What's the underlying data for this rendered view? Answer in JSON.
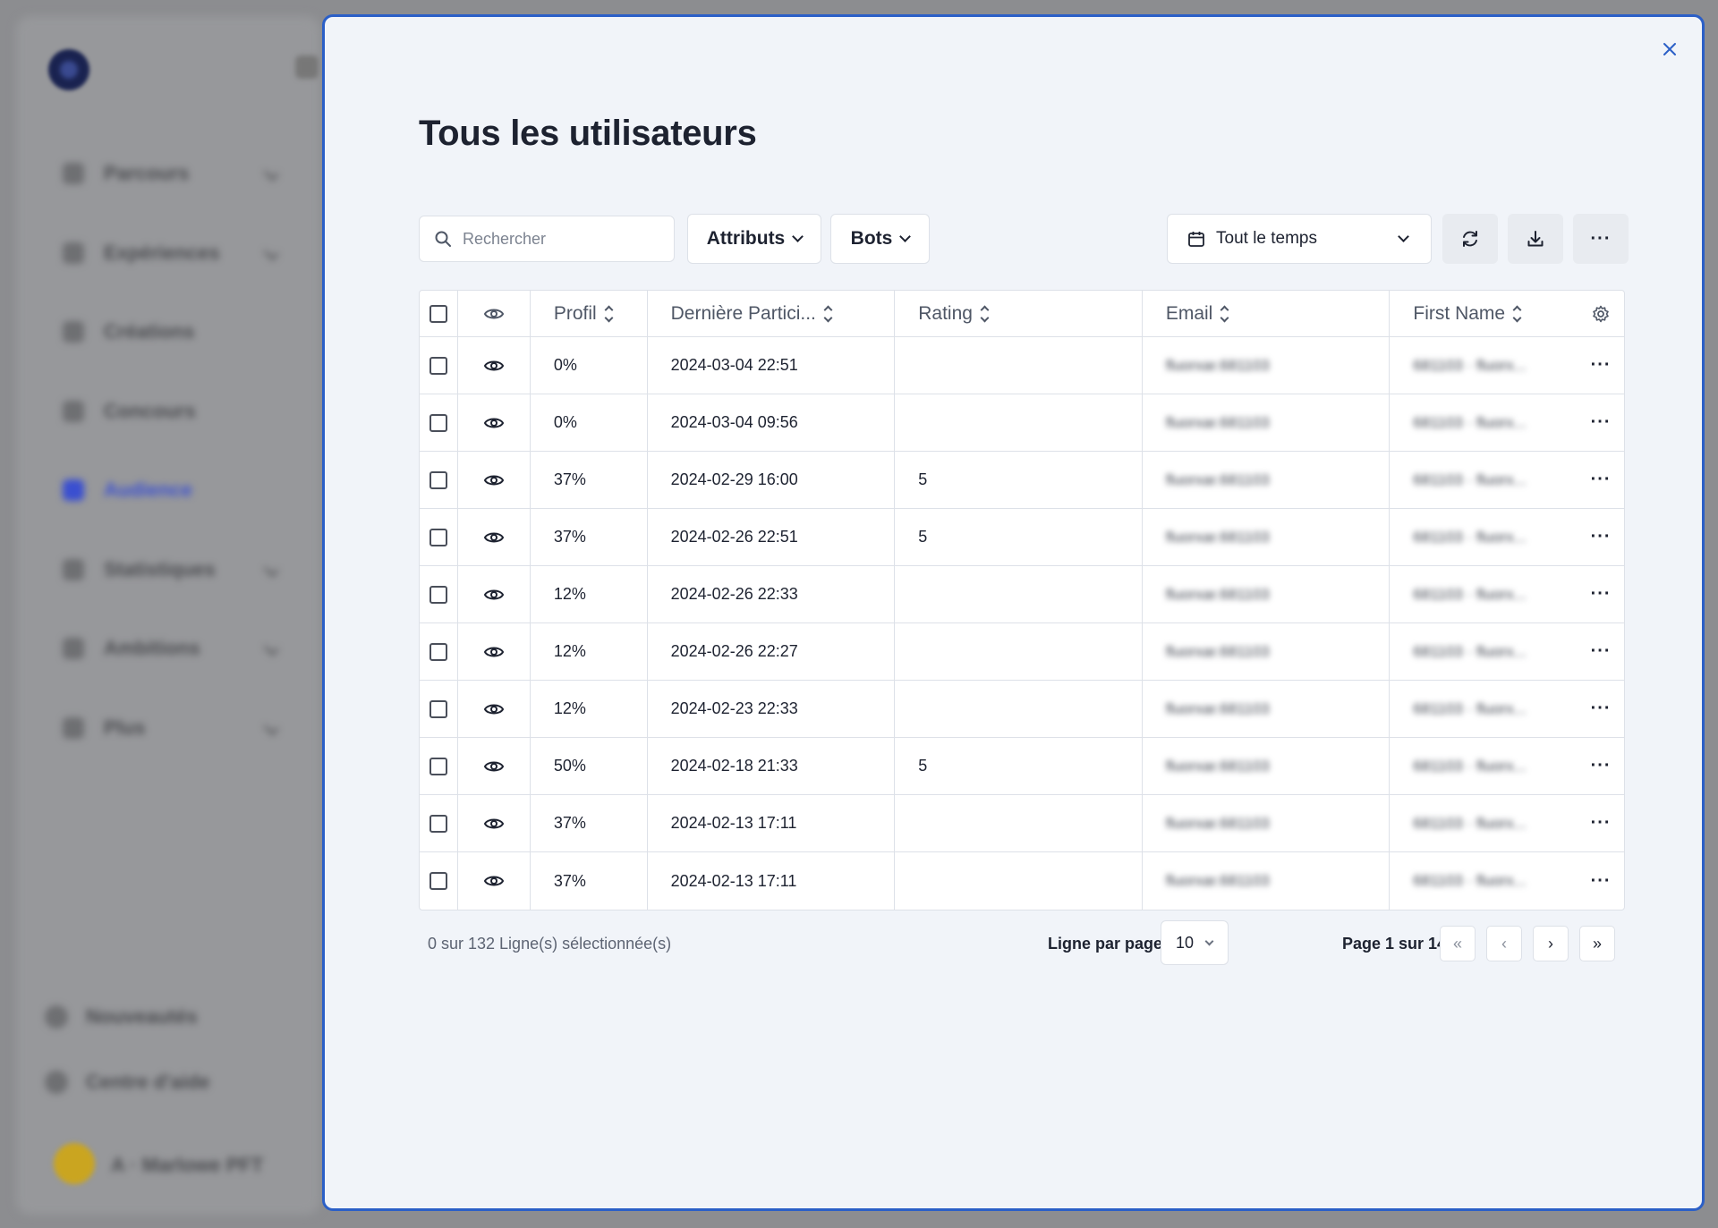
{
  "background": {
    "nav_items": [
      {
        "label": "Parcours",
        "chevron": true
      },
      {
        "label": "Expériences",
        "chevron": true
      },
      {
        "label": "Créations",
        "chevron": false
      },
      {
        "label": "Concours",
        "chevron": false
      },
      {
        "label": "Audience",
        "chevron": false,
        "active": true
      },
      {
        "label": "Statistiques",
        "chevron": true
      },
      {
        "label": "Ambitions",
        "chevron": true
      },
      {
        "label": "Plus",
        "chevron": true
      }
    ],
    "footer_items": [
      "Nouveautés",
      "Centre d'aide"
    ],
    "user_name": "A · Marlowe PFT",
    "accent": "#3a4fd0"
  },
  "modal": {
    "title": "Tous les utilisateurs",
    "close_icon": "close-icon",
    "accent": "#2b5fc7"
  },
  "toolbar": {
    "search_placeholder": "Rechercher",
    "attributes_label": "Attributs",
    "bots_label": "Bots",
    "date_range_label": "Tout le temps"
  },
  "table": {
    "columns": {
      "profile": "Profil",
      "last_participation": "Dernière Partici...",
      "rating": "Rating",
      "email": "Email",
      "first_name": "First Name"
    },
    "rows": [
      {
        "profile": "0%",
        "date": "2024-03-04 22:51",
        "rating": "",
        "email": "fluorxar.681103",
        "first_name": "681103 · fluorx..."
      },
      {
        "profile": "0%",
        "date": "2024-03-04 09:56",
        "rating": "",
        "email": "fluorxar.681103",
        "first_name": "681103 · fluorx..."
      },
      {
        "profile": "37%",
        "date": "2024-02-29 16:00",
        "rating": "5",
        "email": "fluorxar.681103",
        "first_name": "681103 · fluorx..."
      },
      {
        "profile": "37%",
        "date": "2024-02-26 22:51",
        "rating": "5",
        "email": "fluorxar.681103",
        "first_name": "681103 · fluorx..."
      },
      {
        "profile": "12%",
        "date": "2024-02-26 22:33",
        "rating": "",
        "email": "fluorxar.681103",
        "first_name": "681103 · fluorx..."
      },
      {
        "profile": "12%",
        "date": "2024-02-26 22:27",
        "rating": "",
        "email": "fluorxar.681103",
        "first_name": "681103 · fluorx..."
      },
      {
        "profile": "12%",
        "date": "2024-02-23 22:33",
        "rating": "",
        "email": "fluorxar.681103",
        "first_name": "681103 · fluorx..."
      },
      {
        "profile": "50%",
        "date": "2024-02-18 21:33",
        "rating": "5",
        "email": "fluorxar.681103",
        "first_name": "681103 · fluorx..."
      },
      {
        "profile": "37%",
        "date": "2024-02-13 17:11",
        "rating": "",
        "email": "fluorxar.681103",
        "first_name": "681103 · fluorx..."
      },
      {
        "profile": "37%",
        "date": "2024-02-13 17:11",
        "rating": "",
        "email": "fluorxar.681103",
        "first_name": "681103 · fluorx..."
      }
    ]
  },
  "footer": {
    "selection_text": "0 sur 132 Ligne(s) sélectionnée(s)",
    "rows_per_page_label": "Ligne par page",
    "rows_per_page_value": "10",
    "page_info": "Page 1 sur 14",
    "first_label": "«",
    "prev_label": "‹",
    "next_label": "›",
    "last_label": "»"
  }
}
